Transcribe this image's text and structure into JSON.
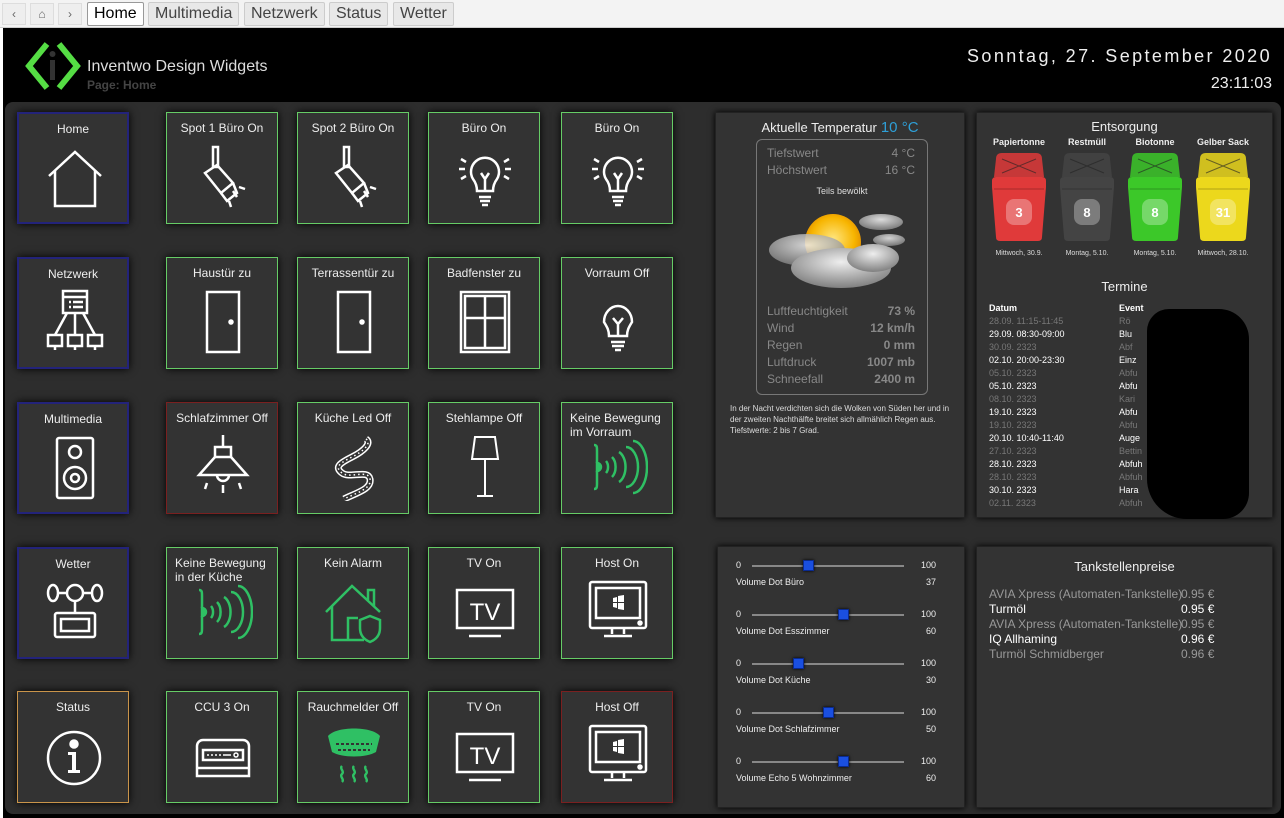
{
  "nav": {
    "back": "‹",
    "home": "⌂",
    "forward": "›",
    "tabs": [
      {
        "label": "Home",
        "active": true
      },
      {
        "label": "Multimedia"
      },
      {
        "label": "Netzwerk"
      },
      {
        "label": "Status"
      },
      {
        "label": "Wetter"
      }
    ]
  },
  "header": {
    "title": "Inventwo Design Widgets",
    "subtitle": "Page: Home",
    "date": "Sonntag, 27. September 2020",
    "time": "23:11:03",
    "accent": "#55dd44"
  },
  "tiles": [
    {
      "label": "Home",
      "icon": "house-icon",
      "state": "nav"
    },
    {
      "label": "Spot 1 Büro On",
      "icon": "spotlight-icon",
      "state": "on"
    },
    {
      "label": "Spot 2 Büro On",
      "icon": "spotlight-icon",
      "state": "on"
    },
    {
      "label": "Büro On",
      "icon": "bulb-on-icon",
      "state": "on"
    },
    {
      "label": "Büro On",
      "icon": "bulb-on-icon",
      "state": "on"
    },
    {
      "label": "Netzwerk",
      "icon": "network-icon",
      "state": "nav"
    },
    {
      "label": "Haustür zu",
      "icon": "door-icon",
      "state": "on"
    },
    {
      "label": "Terrassentür zu",
      "icon": "door-icon",
      "state": "on"
    },
    {
      "label": "Badfenster zu",
      "icon": "window-icon",
      "state": "on"
    },
    {
      "label": "Vorraum Off",
      "icon": "bulb-icon",
      "state": "on"
    },
    {
      "label": "Multimedia",
      "icon": "speaker-icon",
      "state": "nav"
    },
    {
      "label": "Schlafzimmer Off",
      "icon": "ceiling-lamp-icon",
      "state": "red"
    },
    {
      "label": "Küche Led Off",
      "icon": "led-strip-icon",
      "state": "on"
    },
    {
      "label": "Stehlampe Off",
      "icon": "floor-lamp-icon",
      "state": "on"
    },
    {
      "label": "Keine Bewegung im Vorraum",
      "icon": "motion-sensor-icon",
      "state": "on"
    },
    {
      "label": "Wetter",
      "icon": "weather-station-icon",
      "state": "nav"
    },
    {
      "label": "Keine Bewegung in der Küche",
      "icon": "motion-sensor-icon",
      "state": "on"
    },
    {
      "label": "Kein Alarm",
      "icon": "house-shield-icon",
      "state": "on"
    },
    {
      "label": "TV On",
      "icon": "tv-icon",
      "state": "on"
    },
    {
      "label": "Host On",
      "icon": "computer-icon",
      "state": "on"
    },
    {
      "label": "Status",
      "icon": "info-icon",
      "state": "orange"
    },
    {
      "label": "CCU 3 On",
      "icon": "ccu-icon",
      "state": "on"
    },
    {
      "label": "Rauchmelder Off",
      "icon": "smoke-detector-icon",
      "state": "on"
    },
    {
      "label": "TV On",
      "icon": "tv-icon",
      "state": "on"
    },
    {
      "label": "Host Off",
      "icon": "computer-icon",
      "state": "red"
    }
  ],
  "weather": {
    "title": "Aktuelle Temperatur",
    "temp": "10 °C",
    "rows": [
      {
        "label": "Tiefstwert",
        "value": "4 °C"
      },
      {
        "label": "Höchstwert",
        "value": "16 °C"
      }
    ],
    "condition": "Teils bewölkt",
    "details": [
      {
        "label": "Luftfeuchtigkeit",
        "value": "73 %"
      },
      {
        "label": "Wind",
        "value": "12 km/h"
      },
      {
        "label": "Regen",
        "value": "0 mm"
      },
      {
        "label": "Luftdruck",
        "value": "1007 mb"
      },
      {
        "label": "Schneefall",
        "value": "2400 m"
      }
    ],
    "forecast": "In der Nacht verdichten sich die Wolken von Süden her und in der zweiten Nachthälfte breitet sich allmählich Regen aus. Tiefstwerte: 2 bis 7 Grad."
  },
  "disposal": {
    "title": "Entsorgung",
    "bins": [
      {
        "name": "Papiertonne",
        "days": "3",
        "date": "Mittwoch, 30.9.",
        "color": "#e03a3a"
      },
      {
        "name": "Restmüll",
        "days": "8",
        "date": "Montag, 5.10.",
        "color": "#444444"
      },
      {
        "name": "Biotonne",
        "days": "8",
        "date": "Montag, 5.10.",
        "color": "#3cc829"
      },
      {
        "name": "Gelber Sack",
        "days": "31",
        "date": "Mittwoch, 28.10.",
        "color": "#ecd81c"
      }
    ],
    "calendar_title": "Termine",
    "cal_headers": {
      "date": "Datum",
      "event": "Event"
    },
    "events": [
      {
        "date": "28.09. 11:15-11:45",
        "event": "Rö",
        "bold": false
      },
      {
        "date": "29.09. 08:30-09:00",
        "event": "Blu",
        "bold": true
      },
      {
        "date": "30.09. 2323",
        "event": "Abf",
        "bold": false
      },
      {
        "date": "02.10. 20:00-23:30",
        "event": "Einz",
        "bold": true
      },
      {
        "date": "05.10. 2323",
        "event": "Abfu",
        "bold": false
      },
      {
        "date": "05.10. 2323",
        "event": "Abfu",
        "bold": true
      },
      {
        "date": "08.10. 2323",
        "event": "Kari",
        "bold": false
      },
      {
        "date": "19.10. 2323",
        "event": "Abfu",
        "bold": true
      },
      {
        "date": "19.10. 2323",
        "event": "Abfu",
        "bold": false
      },
      {
        "date": "20.10. 10:40-11:40",
        "event": "Auge",
        "bold": true
      },
      {
        "date": "27.10. 2323",
        "event": "Bettin",
        "bold": false
      },
      {
        "date": "28.10. 2323",
        "event": "Abfuh",
        "bold": true
      },
      {
        "date": "28.10. 2323",
        "event": "Abfuh",
        "bold": false
      },
      {
        "date": "30.10. 2323",
        "event": "Hara",
        "bold": true
      },
      {
        "date": "02.11. 2323",
        "event": "Abfuh",
        "bold": false
      }
    ]
  },
  "volumes": [
    {
      "name": "Volume Dot Büro",
      "min": "0",
      "max": "100",
      "value": 37
    },
    {
      "name": "Volume Dot Esszimmer",
      "min": "0",
      "max": "100",
      "value": 60
    },
    {
      "name": "Volume Dot Küche",
      "min": "0",
      "max": "100",
      "value": 30
    },
    {
      "name": "Volume Dot Schlafzimmer",
      "min": "0",
      "max": "100",
      "value": 50
    },
    {
      "name": "Volume Echo 5 Wohnzimmer",
      "min": "0",
      "max": "100",
      "value": 60
    }
  ],
  "fuel": {
    "title": "Tankstellenpreise",
    "stations": [
      {
        "name": "AVIA Xpress (Automaten-Tankstelle)",
        "price": "0.95 €",
        "highlight": false
      },
      {
        "name": "Turmöl",
        "price": "0.95 €",
        "highlight": true
      },
      {
        "name": "AVIA Xpress (Automaten-Tankstelle)",
        "price": "0.95 €",
        "highlight": false
      },
      {
        "name": "IQ Allhaming",
        "price": "0.96 €",
        "highlight": true
      },
      {
        "name": "Turmöl Schmidberger",
        "price": "0.96 €",
        "highlight": false
      }
    ]
  }
}
